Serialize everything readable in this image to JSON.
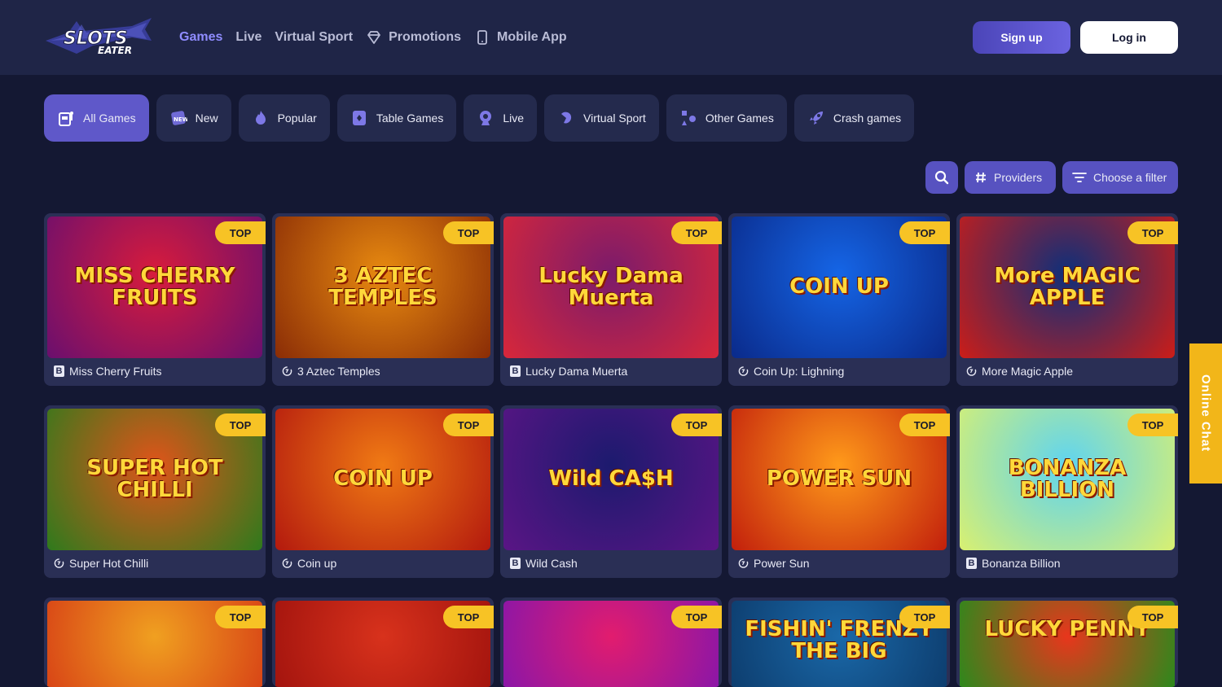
{
  "brand": {
    "logo_line1": "SLOTS",
    "logo_line2": "EATER"
  },
  "nav": [
    {
      "label": "Games",
      "icon": "",
      "active": true
    },
    {
      "label": "Live",
      "icon": "",
      "active": false
    },
    {
      "label": "Virtual Sport",
      "icon": "",
      "active": false
    },
    {
      "label": "Promotions",
      "icon": "diamond-icon",
      "active": false
    },
    {
      "label": "Mobile App",
      "icon": "phone-icon",
      "active": false
    }
  ],
  "auth": {
    "signup": "Sign up",
    "login": "Log in"
  },
  "tabs": [
    {
      "label": "All Games",
      "icon": "slot-machine-icon",
      "active": true
    },
    {
      "label": "New",
      "icon": "new-icon"
    },
    {
      "label": "Popular",
      "icon": "flame-icon"
    },
    {
      "label": "Table Games",
      "icon": "card-icon"
    },
    {
      "label": "Live",
      "icon": "webcam-icon"
    },
    {
      "label": "Virtual Sport",
      "icon": "ball-icon"
    },
    {
      "label": "Other Games",
      "icon": "shapes-icon"
    },
    {
      "label": "Crash games",
      "icon": "rocket-icon"
    }
  ],
  "filters": {
    "providers": "Providers",
    "choose": "Choose a filter"
  },
  "badge": "TOP",
  "games": [
    {
      "title": "Miss Cherry Fruits",
      "art": "MISS CHERRY FRUITS",
      "provider": "B",
      "colors": [
        "#d81b3c",
        "#6a0f6e"
      ]
    },
    {
      "title": "3 Aztec Temples",
      "art": "3 AZTEC TEMPLES",
      "provider": "spin",
      "colors": [
        "#e88a10",
        "#8a2c06"
      ]
    },
    {
      "title": "Lucky Dama Muerta",
      "art": "Lucky Dama Muerta",
      "provider": "B",
      "colors": [
        "#7b1b6b",
        "#d8273a"
      ]
    },
    {
      "title": "Coin Up: Lighning",
      "art": "COIN UP",
      "provider": "spin",
      "colors": [
        "#1565e6",
        "#0a2a8a"
      ]
    },
    {
      "title": "More Magic Apple",
      "art": "More MAGIC APPLE",
      "provider": "spin",
      "colors": [
        "#0e2f7a",
        "#cc1d18"
      ]
    },
    {
      "title": "Super Hot Chilli",
      "art": "SUPER HOT CHILLI",
      "provider": "spin",
      "colors": [
        "#e0541a",
        "#2e7a1c"
      ]
    },
    {
      "title": "Coin up",
      "art": "COIN UP",
      "provider": "spin",
      "colors": [
        "#f07a14",
        "#b3190e"
      ]
    },
    {
      "title": "Wild Cash",
      "art": "Wild CA$H",
      "provider": "B",
      "colors": [
        "#1c1a6e",
        "#5a1585"
      ]
    },
    {
      "title": "Power Sun",
      "art": "POWER SUN",
      "provider": "spin",
      "colors": [
        "#ff9a1a",
        "#c21f0c"
      ]
    },
    {
      "title": "Bonanza Billion",
      "art": "BONANZA BILLION",
      "provider": "B",
      "colors": [
        "#5fd4f0",
        "#d9f070"
      ]
    },
    {
      "title": "",
      "art": "",
      "provider": "",
      "colors": [
        "#f0a020",
        "#d84416"
      ]
    },
    {
      "title": "",
      "art": "",
      "provider": "",
      "colors": [
        "#d8321c",
        "#a3140e"
      ]
    },
    {
      "title": "",
      "art": "",
      "provider": "",
      "colors": [
        "#e21c6e",
        "#8a16a8"
      ]
    },
    {
      "title": "",
      "art": "FISHIN' FRENZY THE BIG",
      "provider": "",
      "colors": [
        "#1a68a8",
        "#0d3d6e"
      ]
    },
    {
      "title": "",
      "art": "LUCKY PENNY",
      "provider": "",
      "colors": [
        "#e8361c",
        "#2a8a1c"
      ]
    }
  ],
  "online_chat": "Online Chat"
}
